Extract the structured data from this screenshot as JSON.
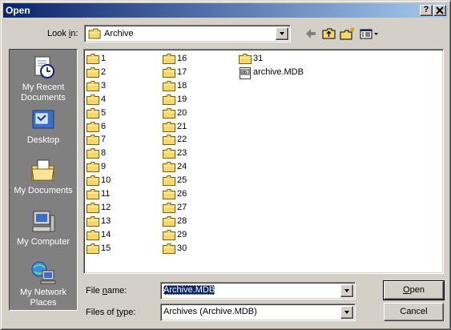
{
  "window": {
    "title": "Open",
    "help_label": "?",
    "close_label": "✕"
  },
  "look_in": {
    "label_underlined": "Look ",
    "label_accel": "i",
    "label_rest": "n:",
    "value": "Archive"
  },
  "toolbar": {
    "icons": [
      "back-icon",
      "up-folder-icon",
      "new-folder-icon",
      "views-menu-icon"
    ]
  },
  "places": [
    {
      "name": "My Recent Documents",
      "icon": "recent-documents-icon"
    },
    {
      "name": "Desktop",
      "icon": "desktop-icon"
    },
    {
      "name": "My Documents",
      "icon": "my-documents-icon"
    },
    {
      "name": "My Computer",
      "icon": "my-computer-icon"
    },
    {
      "name": "My Network Places",
      "icon": "network-places-icon"
    }
  ],
  "files": {
    "column1": [
      "1",
      "2",
      "3",
      "4",
      "5",
      "6",
      "7",
      "8",
      "9",
      "10",
      "11",
      "12",
      "13",
      "14",
      "15"
    ],
    "column2": [
      "16",
      "17",
      "18",
      "19",
      "20",
      "21",
      "22",
      "23",
      "24",
      "25",
      "26",
      "27",
      "28",
      "29",
      "30"
    ],
    "column3": [
      "31"
    ],
    "file": "archive.MDB"
  },
  "file_name": {
    "label_pre": "File ",
    "label_accel": "n",
    "label_rest": "ame:",
    "value": "Archive.MDB"
  },
  "file_type": {
    "label_pre": "Files of ",
    "label_accel": "t",
    "label_rest": "ype:",
    "value": "Archives (Archive.MDB)"
  },
  "buttons": {
    "open_accel": "O",
    "open_rest": "pen",
    "cancel": "Cancel"
  },
  "colors": {
    "titlebar_start": "#0a246a",
    "titlebar_end": "#a6caf0",
    "face": "#d4d0c8",
    "folder_yellow": "#f5d76e"
  }
}
